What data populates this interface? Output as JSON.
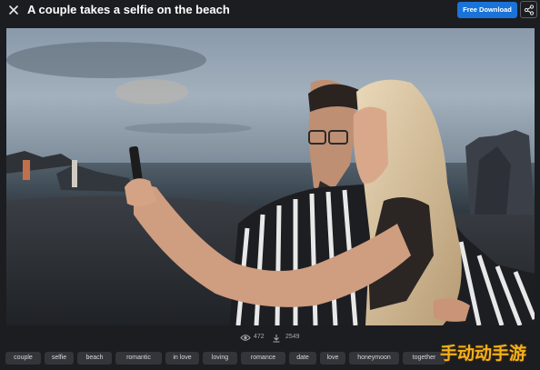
{
  "header": {
    "title": "A couple takes a selfie on the beach",
    "download_label": "Free Download",
    "close_icon": "close-icon",
    "share_icon": "share-icon",
    "accent_color": "#1a73d8"
  },
  "photo": {
    "description_icon": "photo",
    "sky_color": "#7a8a9b",
    "sea_color": "#3e4a55"
  },
  "stats": {
    "views": "472",
    "downloads": "2549"
  },
  "tags": [
    "couple",
    "selfie",
    "beach",
    "romantic",
    "in love",
    "loving",
    "romance",
    "date",
    "love",
    "honeymoon",
    "together"
  ],
  "watermark": "手动动手游"
}
